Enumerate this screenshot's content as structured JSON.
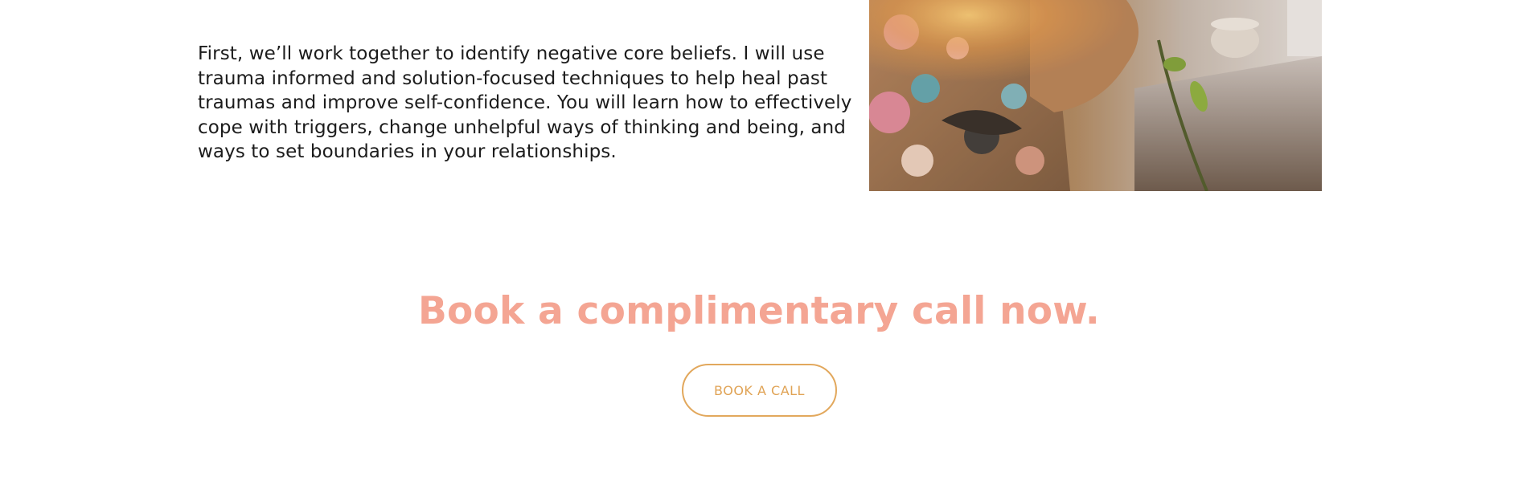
{
  "intro": {
    "paragraph": "First, we’ll work together to identify negative core beliefs. I will use trauma informed and solution-focused techniques to help heal past traumas and improve self-confidence. You will learn how to effectively cope with triggers, change unhelpful ways of thinking and being, and ways to set boundaries in your relationships."
  },
  "photo": {
    "alt": "Person in a floral kimono holding a plant stem near a sunlit window"
  },
  "cta": {
    "heading": "Book a complimentary call now.",
    "button_label": "BOOK A CALL"
  },
  "colors": {
    "heading": "#f4a593",
    "button_border": "#e2a85d",
    "button_text": "#e0a355",
    "body_text": "#1c1c1c"
  }
}
